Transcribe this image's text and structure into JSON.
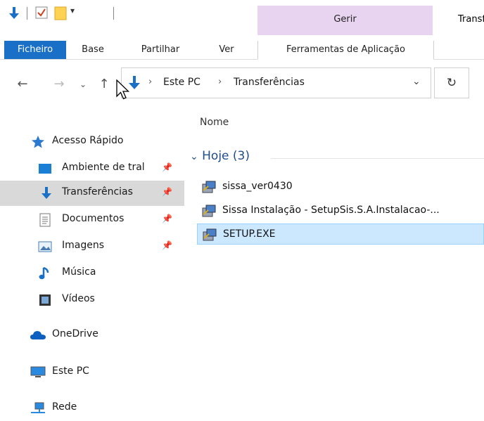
{
  "window": {
    "title": "Transf",
    "context_tab_group": "Gerir"
  },
  "ribbon": {
    "tabs": [
      {
        "label": "Ficheiro"
      },
      {
        "label": "Base"
      },
      {
        "label": "Partilhar"
      },
      {
        "label": "Ver"
      },
      {
        "label": "Ferramentas de Aplicação"
      }
    ]
  },
  "address_bar": {
    "breadcrumbs": [
      "Este PC",
      "Transferências"
    ]
  },
  "sidebar": {
    "items": [
      {
        "label": "Acesso Rápido",
        "icon": "star-icon",
        "pinned": false
      },
      {
        "label": "Ambiente de tral",
        "icon": "desktop-icon",
        "pinned": true
      },
      {
        "label": "Transferências",
        "icon": "download-icon",
        "pinned": true,
        "selected": true
      },
      {
        "label": "Documentos",
        "icon": "document-icon",
        "pinned": true
      },
      {
        "label": "Imagens",
        "icon": "image-icon",
        "pinned": true
      },
      {
        "label": "Música",
        "icon": "music-icon",
        "pinned": false
      },
      {
        "label": "Vídeos",
        "icon": "video-icon",
        "pinned": false
      },
      {
        "label": "OneDrive",
        "icon": "cloud-icon",
        "pinned": false
      },
      {
        "label": "Este PC",
        "icon": "computer-icon",
        "pinned": false
      },
      {
        "label": "Rede",
        "icon": "network-icon",
        "pinned": false
      }
    ]
  },
  "content": {
    "column_header": "Nome",
    "group": {
      "label": "Hoje (3)"
    },
    "files": [
      {
        "name": "sissa_ver0430",
        "icon": "installer-icon"
      },
      {
        "name": "Sissa Instalação - SetupSis.S.A.Instalacao-...",
        "icon": "installer-icon"
      },
      {
        "name": "SETUP.EXE",
        "icon": "installer-icon",
        "selected": true
      }
    ]
  },
  "colors": {
    "accent": "#1a6fc6",
    "context_tab": "#e8d3f0",
    "selection": "#cce8ff"
  }
}
